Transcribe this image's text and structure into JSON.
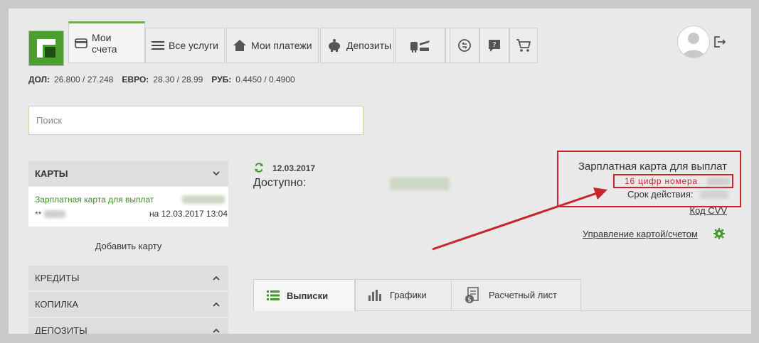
{
  "tabs": {
    "accounts": "Мои счета",
    "services": "Все услуги",
    "payments": "Мои платежи",
    "deposits": "Депозиты"
  },
  "rates": [
    {
      "code": "ДОЛ:",
      "value": "26.800 / 27.248"
    },
    {
      "code": "ЕВРО:",
      "value": "28.30 / 28.99"
    },
    {
      "code": "РУБ:",
      "value": "0.4450 / 0.4900"
    }
  ],
  "search": {
    "placeholder": "Поиск"
  },
  "sidebar": {
    "cards_header": "КАРТЫ",
    "card": {
      "name": "Зарплатная карта для выплат",
      "number_prefix": "**",
      "date": "на 12.03.2017 13:04"
    },
    "add_card": "Добавить карту",
    "sections": [
      "КРЕДИТЫ",
      "КОПИЛКА",
      "ДЕПОЗИТЫ"
    ]
  },
  "balance": {
    "date": "12.03.2017",
    "label": "Доступно:"
  },
  "card_info": {
    "title": "Зарплатная карта для выплат",
    "annotation": "16 цифр номера",
    "expiry_label": "Срок действия:",
    "cvv_link": "Код CVV",
    "manage_link": "Управление картой/счетом"
  },
  "bottom_tabs": [
    "Выписки",
    "Графики",
    "Расчетный лист"
  ],
  "colors": {
    "accent_green": "#6ab04c",
    "annotation_red": "#c8252c"
  }
}
